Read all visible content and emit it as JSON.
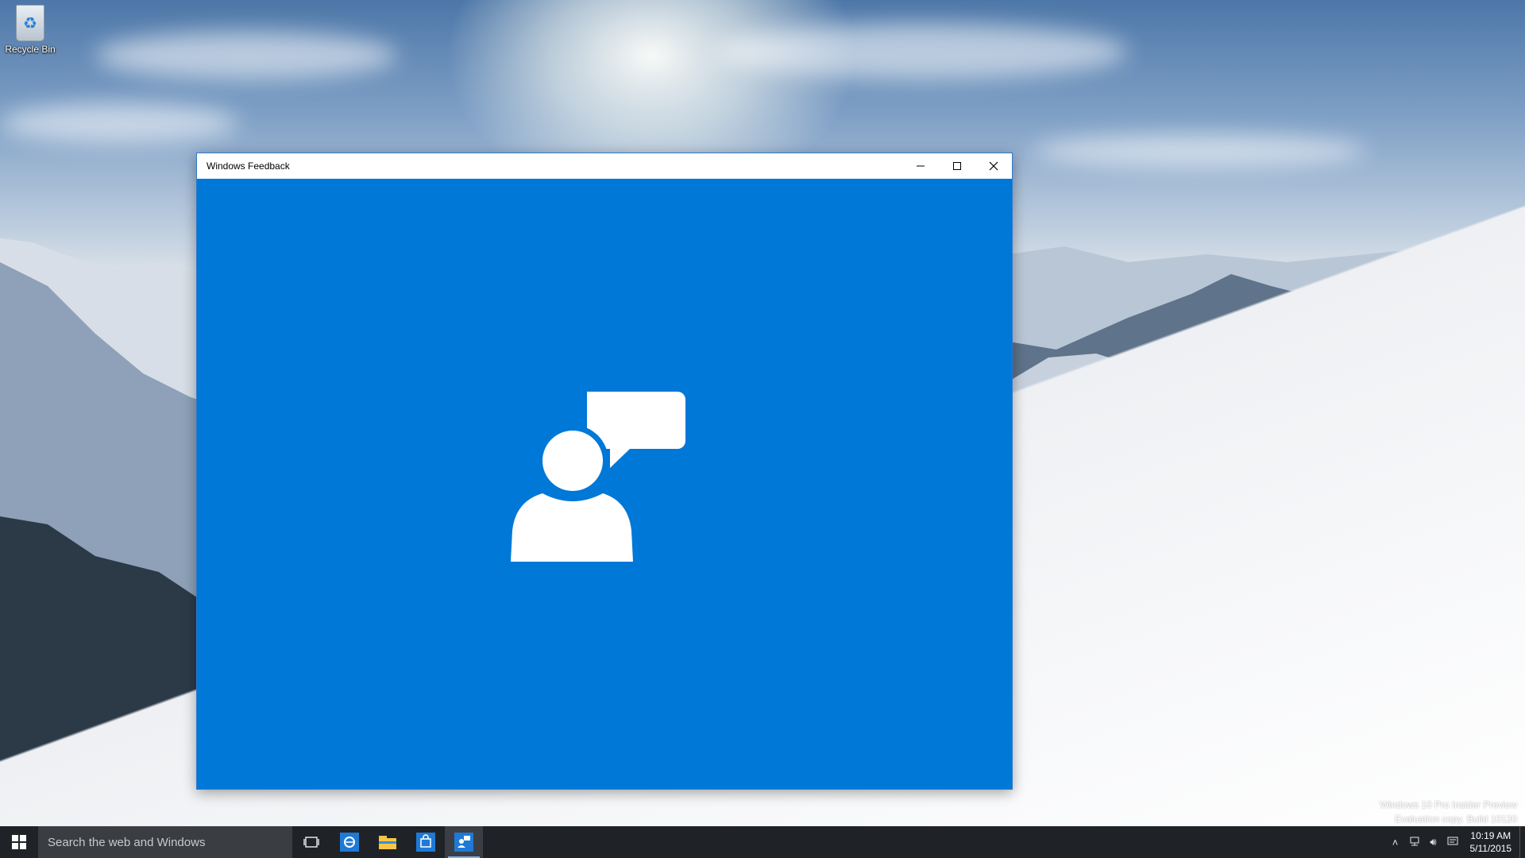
{
  "desktop": {
    "icons": [
      {
        "label": "Recycle Bin",
        "icon": "recycle-bin-icon"
      }
    ]
  },
  "window": {
    "title": "Windows Feedback",
    "controls": {
      "minimize": "—",
      "maximize": "☐",
      "close": "✕"
    },
    "background_color": "#0078d7",
    "splash_icon": "person-speech-bubble-icon"
  },
  "watermark": {
    "line1": "Windows 10 Pro Insider Preview",
    "line2": "Evaluation copy. Build 10120"
  },
  "taskbar": {
    "search_placeholder": "Search the web and Windows",
    "apps": [
      "task-view-icon",
      "internet-explorer-icon",
      "file-explorer-icon",
      "store-icon",
      "windows-feedback-icon"
    ],
    "active_app": "windows-feedback-icon",
    "clock": {
      "time": "10:19 AM",
      "date": "5/11/2015"
    }
  }
}
